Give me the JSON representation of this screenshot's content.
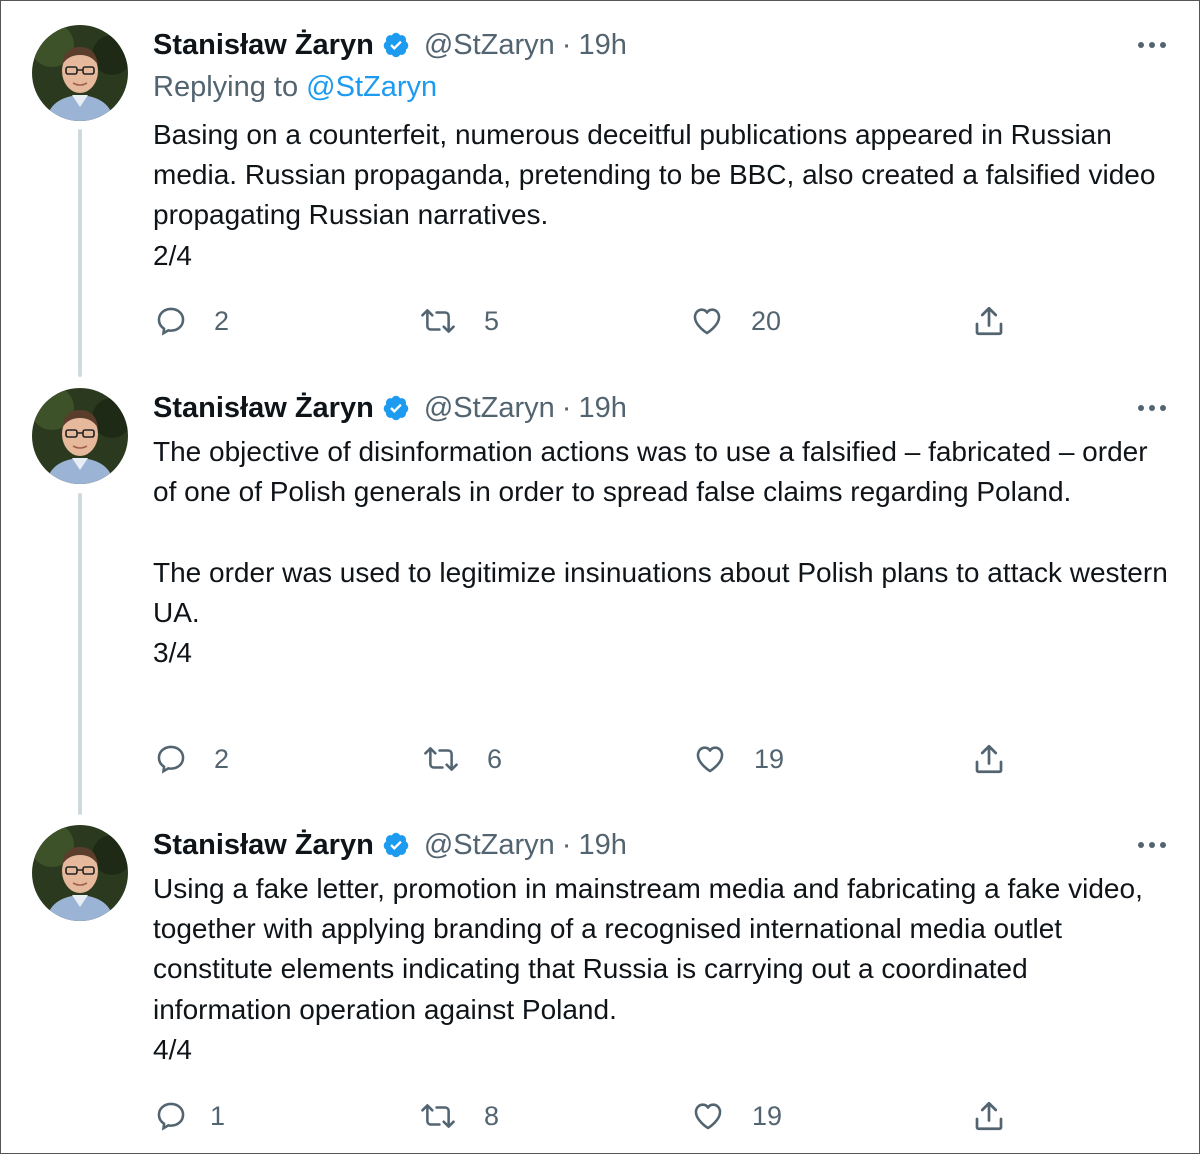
{
  "author": {
    "name": "Stanisław Żaryn",
    "handle": "@StZaryn",
    "separator": "·"
  },
  "tweets": [
    {
      "time": "19h",
      "reply_prefix": "Replying to",
      "reply_mention": "@StZaryn",
      "paragraphs": [
        "Basing on a counterfeit, numerous deceitful publications appeared in Russian media. Russian propaganda, pretending to be BBC, also created a falsified video propagating Russian narratives.",
        "2/4"
      ],
      "replies": "2",
      "retweets": "5",
      "likes": "20"
    },
    {
      "time": "19h",
      "paragraphs": [
        "The objective of disinformation actions was to use a falsified – fabricated – order of one of Polish generals in order to spread false claims regarding Poland.",
        "",
        "The order was used to legitimize insinuations about Polish plans to attack western UA.",
        "3/4"
      ],
      "replies": "2",
      "retweets": "6",
      "likes": "19"
    },
    {
      "time": "19h",
      "paragraphs": [
        "Using a fake letter, promotion in mainstream media and fabricating a fake video, together with applying branding of a recognised international media outlet constitute elements indicating that Russia is carrying out a coordinated information operation against Poland.",
        "4/4"
      ],
      "replies": "1",
      "retweets": "8",
      "likes": "19"
    }
  ],
  "icons": {
    "verified": "verified-badge-icon",
    "more": "more-dots-icon",
    "reply": "reply-bubble-icon",
    "retweet": "retweet-icon",
    "like": "heart-icon",
    "share": "share-icon",
    "avatar": "avatar-photo"
  },
  "colors": {
    "text": "#0f1419",
    "secondary": "#536471",
    "accent": "#1d9bf0",
    "thread_line": "#cfd9de"
  }
}
